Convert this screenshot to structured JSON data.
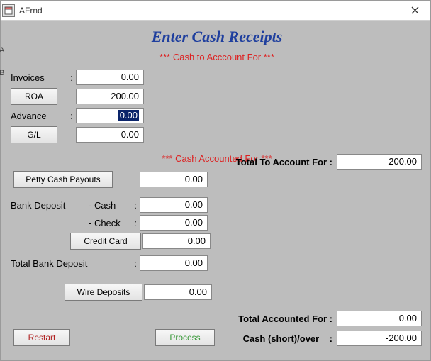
{
  "window": {
    "title": "AFrnd"
  },
  "page": {
    "title": "Enter Cash Receipts"
  },
  "sections": {
    "to_account": "*** Cash to Acccount For ***",
    "accounted": "*** Cash Accounted For ***"
  },
  "fields": {
    "invoices": {
      "label": "Invoices",
      "value": "0.00"
    },
    "roa": {
      "button": "ROA",
      "value": "200.00"
    },
    "advance": {
      "label": "Advance",
      "value": "0.00"
    },
    "gl": {
      "button": "G/L",
      "value": "0.00"
    },
    "total_to_account": {
      "label": "Total To Account For  :",
      "value": "200.00"
    },
    "petty_cash": {
      "button": "Petty Cash Payouts",
      "value": "0.00"
    },
    "bank_deposit": {
      "label": "Bank Deposit"
    },
    "cash": {
      "label": "- Cash",
      "value": "0.00"
    },
    "check": {
      "label": "- Check",
      "value": "0.00"
    },
    "credit_card": {
      "button": "Credit Card",
      "value": "0.00"
    },
    "total_bank_deposit": {
      "label": "Total Bank Deposit",
      "value": "0.00"
    },
    "wire": {
      "button": "Wire Deposits",
      "value": "0.00"
    },
    "total_accounted": {
      "label": "Total Accounted For  :",
      "value": "0.00"
    },
    "cash_short_over": {
      "label": "Cash (short)/over",
      "value": "-200.00"
    }
  },
  "buttons": {
    "restart": "Restart",
    "process": "Process"
  }
}
